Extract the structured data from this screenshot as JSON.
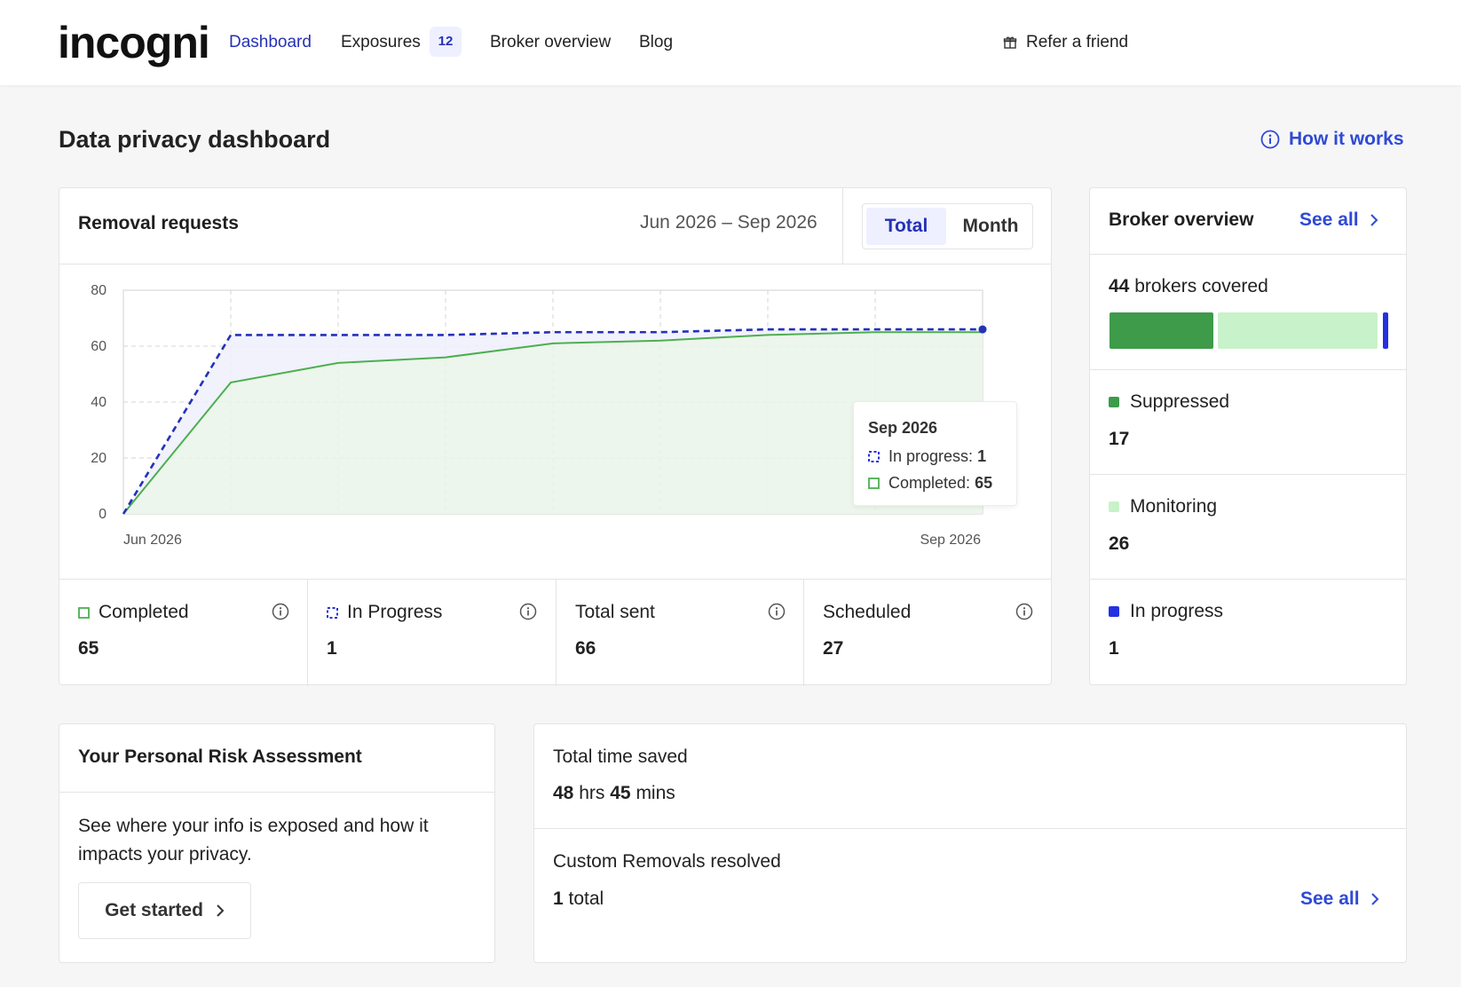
{
  "nav": {
    "logo": "incogni",
    "dashboard": "Dashboard",
    "exposures": "Exposures",
    "exposures_count": "12",
    "broker_overview": "Broker overview",
    "blog": "Blog",
    "refer": "Refer a friend"
  },
  "page": {
    "title": "Data privacy dashboard",
    "how_it_works": "How it works"
  },
  "removal": {
    "title": "Removal requests",
    "date_range": "Jun 2026 – Sep 2026",
    "toggle_total": "Total",
    "toggle_month": "Month",
    "tooltip": {
      "title": "Sep 2026",
      "in_progress_label": "In progress:",
      "in_progress_value": "1",
      "completed_label": "Completed:",
      "completed_value": "65"
    },
    "stats": [
      {
        "label": "Completed",
        "value": "65"
      },
      {
        "label": "In Progress",
        "value": "1"
      },
      {
        "label": "Total sent",
        "value": "66"
      },
      {
        "label": "Scheduled",
        "value": "27"
      }
    ]
  },
  "chart_data": {
    "type": "area",
    "x_start_label": "Jun 2026",
    "x_end_label": "Sep 2026",
    "y_ticks": [
      "80",
      "60",
      "40",
      "20",
      "0"
    ],
    "ylim": [
      0,
      80
    ],
    "grid": true,
    "series": [
      {
        "name": "Total",
        "style": "dashed",
        "color": "#2531b8",
        "values": [
          0,
          64,
          64,
          64,
          65,
          65,
          66,
          66,
          66
        ]
      },
      {
        "name": "Completed",
        "style": "solid",
        "color": "#4caf50",
        "values": [
          0,
          47,
          54,
          56,
          61,
          62,
          64,
          65,
          65
        ]
      }
    ]
  },
  "broker": {
    "title": "Broker overview",
    "see_all": "See all",
    "covered_count": "44",
    "covered_text": "brokers covered",
    "items": [
      {
        "label": "Suppressed",
        "value": "17",
        "color": "#3d9b4a"
      },
      {
        "label": "Monitoring",
        "value": "26",
        "color": "#c8f2c9"
      },
      {
        "label": "In progress",
        "value": "1",
        "color": "#2531e0"
      }
    ]
  },
  "risk": {
    "title": "Your Personal Risk Assessment",
    "text": "See where your info is exposed and how it impacts your privacy.",
    "button": "Get started"
  },
  "savings": {
    "time_label": "Total time saved",
    "hrs": "48",
    "hrs_unit": "hrs",
    "mins": "45",
    "mins_unit": "mins",
    "custom_label": "Custom Removals resolved",
    "custom_count": "1",
    "custom_unit": "total",
    "see_all": "See all"
  }
}
